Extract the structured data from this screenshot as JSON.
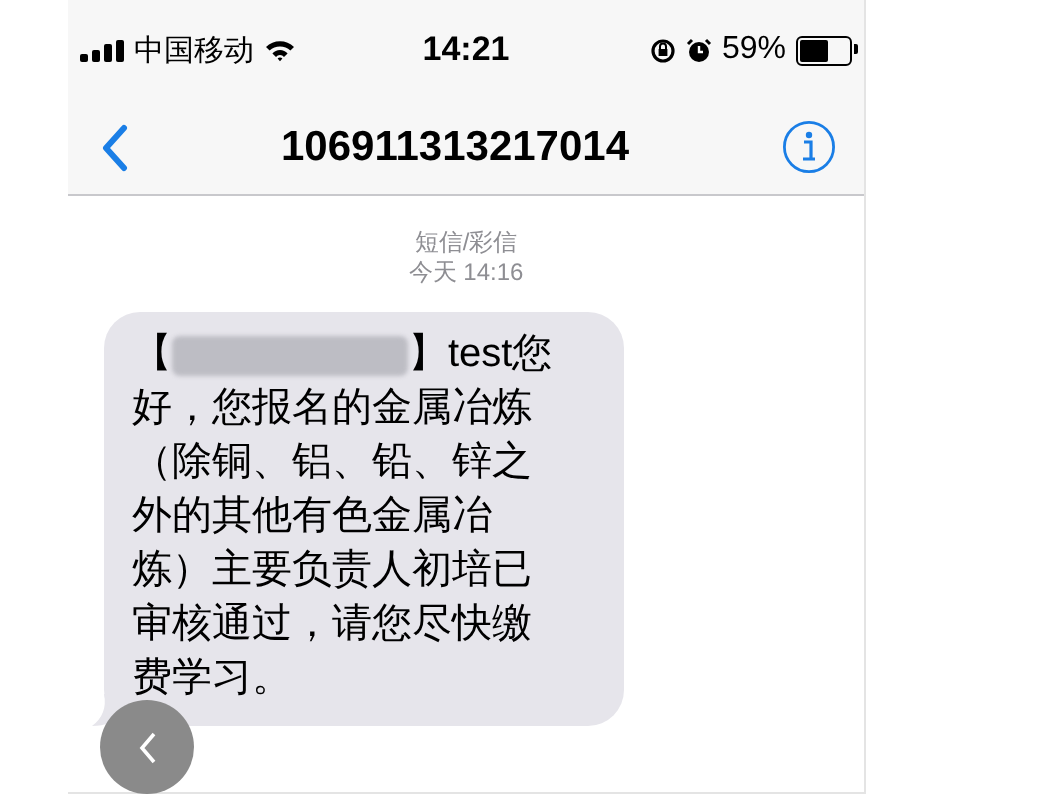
{
  "status_bar": {
    "carrier": "中国移动",
    "time": "14:21",
    "battery": "59%"
  },
  "nav": {
    "title": "106911313217014"
  },
  "message_meta": {
    "service": "短信/彩信",
    "timestamp": "今天 14:16"
  },
  "message": {
    "redacted": true,
    "first_prefix": "【",
    "first_suffix": "】test您",
    "lines": [
      "好，您报名的金属冶炼",
      "（除铜、铝、铅、锌之",
      "外的其他有色金属冶",
      "炼）主要负责人初培已",
      "审核通过，请您尽快缴",
      "费学习。"
    ]
  }
}
